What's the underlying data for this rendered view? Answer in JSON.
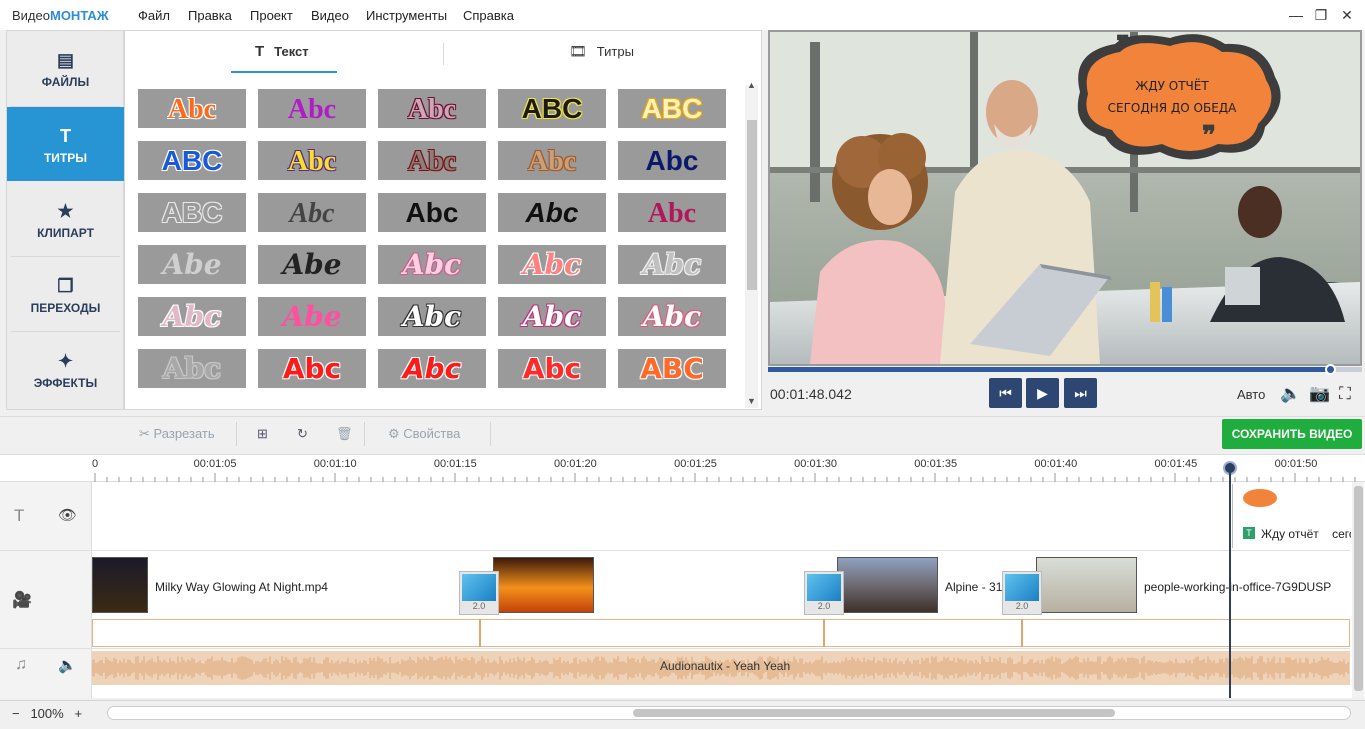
{
  "app": {
    "logo_prefix": "Видео",
    "logo_brand": "МОНТАЖ"
  },
  "menu": [
    "Файл",
    "Правка",
    "Проект",
    "Видео",
    "Инструменты",
    "Справка"
  ],
  "window_controls": [
    "—",
    "❐",
    "✕"
  ],
  "sidebar": {
    "items": [
      {
        "label": "ФАЙЛЫ",
        "icon": "image-icon",
        "glyph": "🖼"
      },
      {
        "label": "ТИТРЫ",
        "icon": "titles-t-icon",
        "glyph": "T"
      },
      {
        "label": "КЛИПАРТ",
        "icon": "star-icon",
        "glyph": "★"
      },
      {
        "label": "ПЕРЕХОДЫ",
        "icon": "transitions-icon",
        "glyph": "❐"
      },
      {
        "label": "ЭФФЕКТЫ",
        "icon": "magic-wand-icon",
        "glyph": "✦"
      }
    ]
  },
  "tabs": [
    {
      "label": "Текст",
      "icon": "text-t-icon"
    },
    {
      "label": "Титры",
      "icon": "film-icon"
    }
  ],
  "text_styles": [
    {
      "text": "Abc",
      "color": "#ff6a1a",
      "stroke": "#ffffff",
      "font": "Liberation Serif",
      "style": "normal"
    },
    {
      "text": "Abc",
      "color": "#b01cc7",
      "stroke": "",
      "font": "Liberation Serif",
      "style": "normal"
    },
    {
      "text": "Abc",
      "color": "#cfa6b8",
      "stroke": "#6b1130",
      "font": "Liberation Serif",
      "style": "normal"
    },
    {
      "text": "ABC",
      "color": "#1a1a1a",
      "stroke": "#f3e43a",
      "font": "Liberation Sans",
      "style": "normal"
    },
    {
      "text": "ABC",
      "color": "#fff4c0",
      "stroke": "#f2a900",
      "font": "Liberation Sans",
      "style": "normal"
    },
    {
      "text": "ABC",
      "color": "#1a5ad8",
      "stroke": "#ffffff",
      "font": "Liberation Sans",
      "style": "normal"
    },
    {
      "text": "Abc",
      "color": "#f7e02a",
      "stroke": "#5a2a8a",
      "font": "Liberation Serif",
      "style": "normal"
    },
    {
      "text": "Abc",
      "color": "#8a7f7f",
      "stroke": "#7d1010",
      "font": "Liberation Serif",
      "style": "normal"
    },
    {
      "text": "Abc",
      "color": "#c9a07a",
      "stroke": "#a05a2a",
      "font": "Liberation Serif",
      "style": "normal"
    },
    {
      "text": "Abc",
      "color": "#0a1a6a",
      "stroke": "",
      "font": "Liberation Sans",
      "style": "normal"
    },
    {
      "text": "ABC",
      "color": "#9a9a9a",
      "stroke": "#e8e8e8",
      "font": "Liberation Sans",
      "style": "normal"
    },
    {
      "text": "Abc",
      "color": "#444444",
      "stroke": "",
      "font": "Liberation Serif",
      "style": "italic"
    },
    {
      "text": "Abc",
      "color": "#111111",
      "stroke": "",
      "font": "Liberation Sans",
      "style": "normal"
    },
    {
      "text": "Abc",
      "color": "#111111",
      "stroke": "",
      "font": "Liberation Sans",
      "style": "italic"
    },
    {
      "text": "Abc",
      "color": "#b0185a",
      "stroke": "",
      "font": "Liberation Serif",
      "style": "normal"
    },
    {
      "text": "Abe",
      "color": "#cfcfcf",
      "stroke": "",
      "font": "DejaVu Serif",
      "style": "italic"
    },
    {
      "text": "Abe",
      "color": "#222222",
      "stroke": "",
      "font": "DejaVu Serif",
      "style": "italic"
    },
    {
      "text": "Abc",
      "color": "#ffd0e0",
      "stroke": "#c86090",
      "font": "DejaVu Serif",
      "style": "italic"
    },
    {
      "text": "Abc",
      "color": "#ff8080",
      "stroke": "#ffffff",
      "font": "DejaVu Serif",
      "style": "italic"
    },
    {
      "text": "Abc",
      "color": "#c0c0c0",
      "stroke": "#f0f0f0",
      "font": "DejaVu Serif",
      "style": "italic"
    },
    {
      "text": "Abc",
      "color": "#e0b8c8",
      "stroke": "#ffffff",
      "font": "DejaVu Serif",
      "style": "italic"
    },
    {
      "text": "Abe",
      "color": "#ff4fa0",
      "stroke": "",
      "font": "DejaVu Serif",
      "style": "italic"
    },
    {
      "text": "Abc",
      "color": "#ffffff",
      "stroke": "#333333",
      "font": "DejaVu Serif",
      "style": "italic"
    },
    {
      "text": "Abc",
      "color": "#ffffff",
      "stroke": "#c0307a",
      "font": "DejaVu Serif",
      "style": "italic"
    },
    {
      "text": "Abc",
      "color": "#ffffff",
      "stroke": "#e05a7a",
      "font": "DejaVu Serif",
      "style": "italic"
    },
    {
      "text": "Abc",
      "color": "#a8a8a8",
      "stroke": "#c8c8c8",
      "font": "DejaVu Serif",
      "style": "normal"
    },
    {
      "text": "Abc",
      "color": "#ff1a1a",
      "stroke": "#ffffff",
      "font": "DejaVu Sans",
      "style": "normal"
    },
    {
      "text": "Abc",
      "color": "#ff1a1a",
      "stroke": "#ffffff",
      "font": "DejaVu Sans",
      "style": "italic"
    },
    {
      "text": "Abc",
      "color": "#ff2a2a",
      "stroke": "#ffffff",
      "font": "DejaVu Sans",
      "style": "normal"
    },
    {
      "text": "ABC",
      "color": "#ff6a2a",
      "stroke": "#ffffff",
      "font": "DejaVu Sans",
      "style": "normal"
    }
  ],
  "preview": {
    "bubble_line1": "ЖДУ ОТЧЁТ",
    "bubble_line2": "СЕГОДНЯ ДО ОБЕДА",
    "time": "00:01:48.042",
    "progress": 0.948,
    "auto_label": "Авто",
    "colors": {
      "bubble": "#f2833a",
      "bubble_border": "#3d3d3d"
    }
  },
  "player": {
    "prev": "⏮",
    "play": "▶",
    "next": "⏭"
  },
  "toolbar": {
    "cut": "Разрезать",
    "properties": "Свойства",
    "save": "СОХРАНИТЬ ВИДЕО"
  },
  "ruler": {
    "ticks": [
      "0",
      "00:01:05",
      "00:01:10",
      "00:01:15",
      "00:01:20",
      "00:01:25",
      "00:01:30",
      "00:01:35",
      "00:01:40",
      "00:01:45",
      "00:01:50"
    ]
  },
  "timeline": {
    "title_clip_text": "Жду отчёт    сего",
    "clips": [
      "Milky Way Glowing At Night.mp4",
      "Alpine - 31",
      "people-working-in-office-7G9DUSP"
    ],
    "transitions": [
      "2.0",
      "2.0",
      "2.0"
    ],
    "audio": "Audionautix - Yeah Yeah"
  },
  "bottom": {
    "zoom": "100%",
    "minus": "−",
    "plus": "+"
  }
}
